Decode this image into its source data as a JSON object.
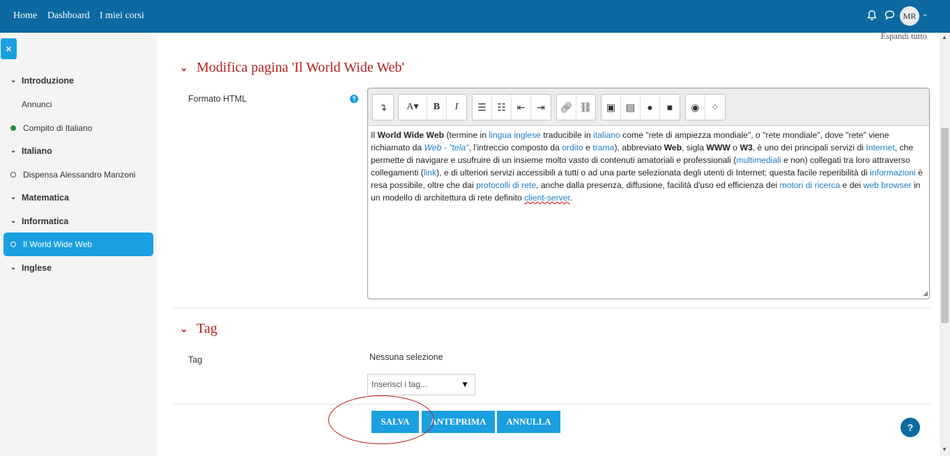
{
  "nav": {
    "home": "Home",
    "dashboard": "Dashboard",
    "courses": "I miei corsi",
    "bell_icon": "bell-icon",
    "chat_icon": "chat-icon",
    "avatar": "MR"
  },
  "sidebar": {
    "close_icon": "×",
    "items": [
      {
        "label": "Introduzione",
        "type": "section"
      },
      {
        "label": "Annunci",
        "type": "item"
      },
      {
        "label": "Compito di Italiano",
        "type": "item",
        "dot": "filled"
      },
      {
        "label": "Italiano",
        "type": "section"
      },
      {
        "label": "Dispensa Alessandro Manzoni",
        "type": "item",
        "dot": "hollow"
      },
      {
        "label": "Matematica",
        "type": "section"
      },
      {
        "label": "Informatica",
        "type": "section"
      },
      {
        "label": "Il World Wide Web",
        "type": "item",
        "dot": "hollow",
        "active": true
      },
      {
        "label": "Inglese",
        "type": "section"
      }
    ]
  },
  "main": {
    "expand_all": "Espandi tutto",
    "section1_title": "Modifica pagina 'Il World Wide Web'",
    "format_label": "Formato HTML",
    "section2_title": "Tag",
    "tag_label": "Tag",
    "no_selection": "Nessuna selezione",
    "tag_placeholder": "Inserisci i tag...",
    "buttons": {
      "save": "SALVA",
      "preview": "ANTEPRIMA",
      "cancel": "ANNULLA"
    }
  },
  "editor_text": {
    "p1": "Il ",
    "b1": "World Wide Web",
    "p2": " (termine in ",
    "l1": "lingua inglese",
    "p3": " traducibile in ",
    "l2": "italiano",
    "p4": " come \"rete di ampiezza mondiale\", o \"rete mondiale\", dove \"rete\" viene richiamato da ",
    "l3": "Web - \"tela\"",
    "p5": ", l'intreccio composto da ",
    "l4": "ordito",
    "p6": " e ",
    "l5": "trama",
    "p7": "), abbreviato ",
    "b2": "Web",
    "p8": ", sigla ",
    "b3": "WWW",
    "p9": " o ",
    "b4": "W3",
    "p10": ", è uno dei principali servizi di ",
    "l6": "Internet",
    "p11": ", che permette di navigare e usufruire di un insieme molto vasto di contenuti amatoriali e professionali (",
    "l7": "multimediali",
    "p12": " e non) collegati tra loro attraverso collegamenti (",
    "l8": "link",
    "p13": "), e di ulteriori servizi accessibili a tutti o ad una parte selezionata degli utenti di Internet; questa facile reperibilità di ",
    "l9": "informazioni",
    "p14": " è resa possibile, oltre che dai ",
    "l10": "protocolli di rete",
    "p15": ", anche dalla presenza, diffusione, facilità d'uso ed efficienza dei ",
    "l11": "motori di ricerca",
    "p16": " e dei ",
    "l12": "web browser",
    "p17": " in un modello di architettura di rete definito ",
    "l13": "client-server",
    "p18": "."
  },
  "colors": {
    "topbar": "#0b6aa1",
    "accent": "#1a9fe0",
    "title_red": "#b21e1e"
  }
}
